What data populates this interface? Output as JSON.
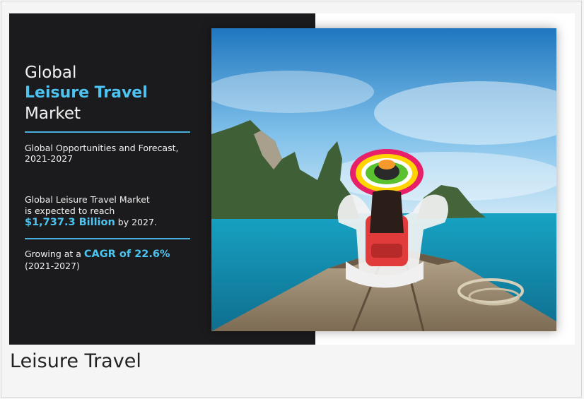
{
  "infographic": {
    "title_line1": "Global",
    "title_line2": "Leisure Travel",
    "title_line3": "Market",
    "subtitle": "Global Opportunities and Forecast,",
    "subtitle_years": "2021-2027",
    "reach_line1": "Global Leisure Travel Market",
    "reach_line2": "is expected to reach",
    "reach_value": "$1,737.3 Billion",
    "reach_suffix": " by 2027.",
    "growth_prefix": "Growing at a ",
    "growth_value": "CAGR of 22.6%",
    "growth_years": "(2021-2027)",
    "accent_color": "#4cc3f0",
    "panel_color": "#1b1b1d"
  },
  "caption": "Leisure Travel"
}
